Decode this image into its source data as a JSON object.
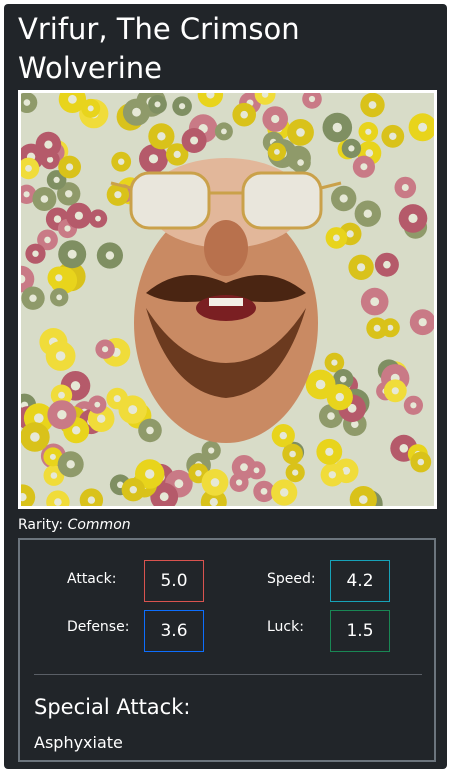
{
  "card": {
    "title": "Vrifur, The Crimson Wolverine",
    "rarity_label": "Rarity:",
    "rarity_value": "Common"
  },
  "stats": {
    "attack": {
      "label": "Attack:",
      "value": "5.0",
      "color": "#d9534f"
    },
    "speed": {
      "label": "Speed:",
      "value": "4.2",
      "color": "#17a2b8"
    },
    "defense": {
      "label": "Defense:",
      "value": "3.6",
      "color": "#0d6efd"
    },
    "luck": {
      "label": "Luck:",
      "value": "1.5",
      "color": "#198754"
    }
  },
  "special": {
    "heading": "Special Attack:",
    "name": "Asphyxiate"
  },
  "colors": {
    "card_bg": "#212529",
    "box_border": "#6c757d"
  }
}
